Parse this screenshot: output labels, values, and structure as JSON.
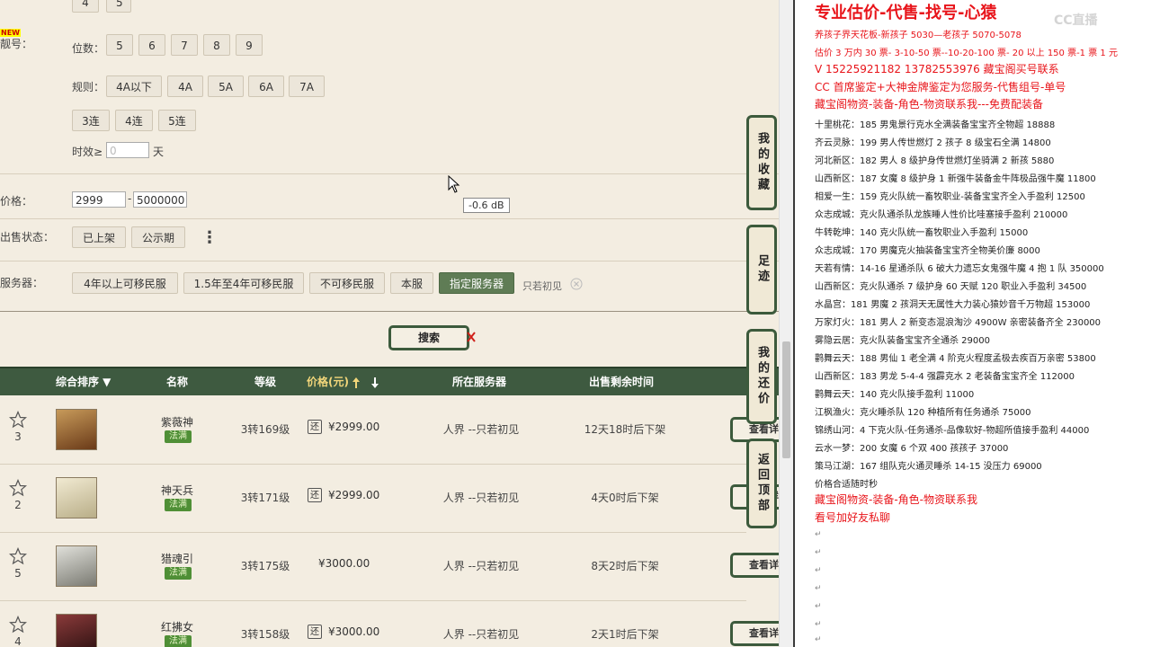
{
  "filters": {
    "top_buttons": [
      "4",
      "5"
    ],
    "new_badge": "NEW",
    "haohao_label": "靓号：",
    "digits_label": "位数：",
    "digits": [
      "5",
      "6",
      "7",
      "8",
      "9"
    ],
    "rules_label": "规则：",
    "rules": [
      "4A以下",
      "4A",
      "5A",
      "6A",
      "7A"
    ],
    "lian": [
      "3连",
      "4连",
      "5连"
    ],
    "timeliness_label": "时效≥",
    "timeliness_value": "0",
    "timeliness_unit": "天",
    "price_label": "价格：",
    "price_min": "2999",
    "price_sep": "-",
    "price_max": "5000000",
    "status_label": "出售状态：",
    "status_options": [
      "已上架",
      "公示期"
    ],
    "more_icon": "⋮",
    "server_label": "服务器：",
    "server_options": [
      "4年以上可移民服",
      "1.5年至4年可移民服",
      "不可移民服",
      "本服",
      "指定服务器"
    ],
    "server_selected": "只若初见",
    "search_label": "搜索"
  },
  "tooltip": "-0.6 dB",
  "table": {
    "headers": {
      "rank": "综合排序 ▼",
      "name": "名称",
      "level": "等级",
      "price": "价格(元)",
      "server": "所在服务器",
      "time": "出售剩余时间"
    },
    "rows": [
      {
        "fav": "3",
        "name": "紫薇神",
        "tag": "法满",
        "level": "3转169级",
        "huan": "还",
        "price": "¥2999.00",
        "server": "人界 --只若初见",
        "time": "12天18时后下架",
        "avatar_color": "#8a5a2a"
      },
      {
        "fav": "2",
        "name": "神天兵",
        "tag": "法满",
        "level": "3转171级",
        "huan": "还",
        "price": "¥2999.00",
        "server": "人界 --只若初见",
        "time": "4天0时后下架",
        "avatar_color": "#d8cfb0"
      },
      {
        "fav": "5",
        "name": "猎魂引",
        "tag": "法满",
        "level": "3转175级",
        "huan": "",
        "price": "¥3000.00",
        "server": "人界 --只若初见",
        "time": "8天2时后下架",
        "avatar_color": "#b9b9b0"
      },
      {
        "fav": "4",
        "name": "红拂女",
        "tag": "法满",
        "level": "3转158级",
        "huan": "还",
        "price": "¥3000.00",
        "server": "人界 --只若初见",
        "time": "2天1时后下架",
        "avatar_color": "#6a2a30"
      }
    ],
    "view_label": "查看详"
  },
  "side_tabs": [
    "我的收藏",
    "足迹",
    "我的还价",
    "返回顶部"
  ],
  "notes": {
    "watermark": "CC直播",
    "title": "专业估价-代售-找号-心猿",
    "lines_red": [
      "养孩子界天花板-新孩子 5030—老孩子 5070-5078",
      "估价 3 万内 30 票- 3-10-50 票--10-20-100 票- 20 以上 150 票-1 票 1 元",
      "V 15225921182       13782553976     藏宝阁买号联系",
      "CC 首席鉴定+大神金牌鉴定为您服务-代售组号-单号",
      "藏宝阁物资-装备-角色-物资联系我---免费配装备"
    ],
    "lines_black": [
      "十里桃花：185 男鬼景行克水全满装备宝宝齐全物超 18888",
      "齐云灵脉：199 男人传世燃灯 2 孩子 8 级宝石全满 14800",
      "河北新区：182 男人 8 级护身传世燃灯坐骑满 2 新孩 5880",
      "山西新区：187 女魔 8 级护身 1 新强牛装备金牛阵极品强牛魔 11800",
      "相爱一生：159 克火队统一畜牧职业-装备宝宝齐全入手盈利 12500",
      "众志成城：克火队通杀队龙族睡人性价比哇塞接手盈利 210000",
      "牛转乾坤：140 克火队统一畜牧职业入手盈利 15000",
      "众志成城：170 男魔克火抽装备宝宝齐全物美价廉 8000",
      "天若有情：14-16 星通杀队 6 破大力遗忘女鬼强牛魔 4 抱 1 队 350000",
      "山西新区：克火队通杀 7 级护身 60 天赋 120 职业入手盈利 34500",
      "水晶宫：181 男魔 2 孩洞天无属性大力装心猿妙音千万物超 153000",
      "万家灯火：181 男人 2 新变态混浪淘沙 4900W 亲密装备齐全 230000",
      "雾隐云居：克火队装备宝宝齐全通杀 29000",
      "鹳舞云天：188 男仙 1 老全满 4 阶克火程度孟极去疾百万亲密 53800",
      "山西新区：183 男龙 5-4-4 强霹克水 2 老装备宝宝齐全 112000",
      "鹳舞云天：140 克火队接手盈利 11000",
      "江枫渔火：克火睡杀队 120 种植所有任务通杀 75000",
      "锦绣山河：4 下克火队-任务通杀-品像软好-物超所值接手盈利 44000",
      "云水一梦：200 女魔 6 个双 400 孩孩子 37000",
      "策马江湖：167 组队克火通灵睡杀 14-15 没压力 69000",
      "价格合适随时秒"
    ],
    "lines_red_end": [
      "藏宝阁物资-装备-角色-物资联系我",
      "看号加好友私聊"
    ],
    "para_mark": "↵"
  }
}
